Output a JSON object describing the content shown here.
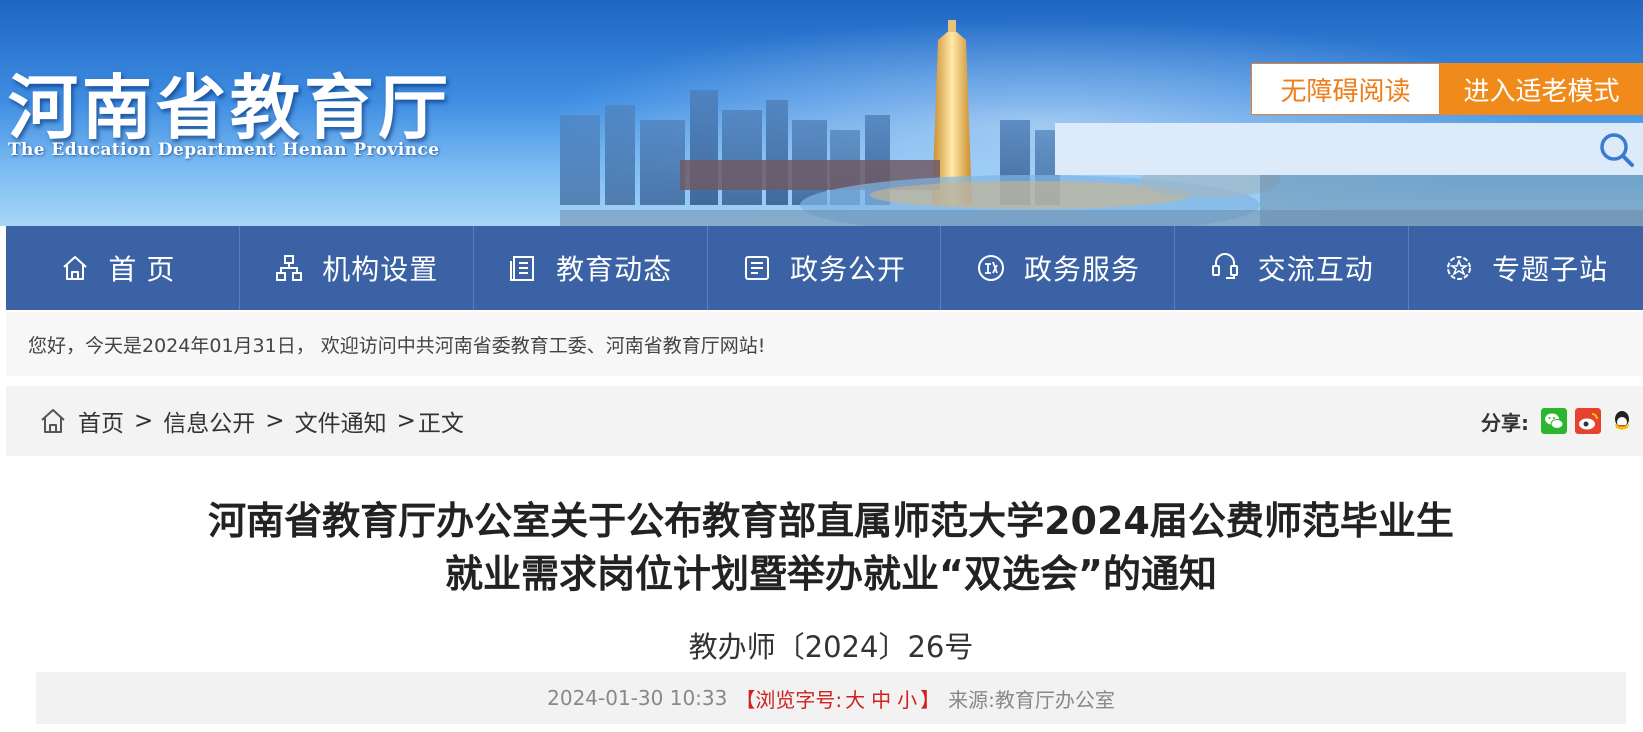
{
  "header": {
    "logo_cn": "河南省教育厅",
    "logo_en": "The Education Department Henan Province",
    "accessible_label": "无障碍阅读",
    "elder_mode_label": "进入适老模式",
    "search_placeholder": ""
  },
  "nav": {
    "items": [
      {
        "label": "首页",
        "icon": "home-icon"
      },
      {
        "label": "机构设置",
        "icon": "org-chart-icon"
      },
      {
        "label": "教育动态",
        "icon": "news-icon"
      },
      {
        "label": "政务公开",
        "icon": "open-gov-icon"
      },
      {
        "label": "政务服务",
        "icon": "gov-service-icon"
      },
      {
        "label": "交流互动",
        "icon": "interaction-icon"
      },
      {
        "label": "专题子站",
        "icon": "topic-site-icon"
      }
    ]
  },
  "welcome": {
    "text": "您好，今天是2024年01月31日， 欢迎访问中共河南省委教育工委、河南省教育厅网站!"
  },
  "breadcrumb": {
    "items": [
      "首页",
      "信息公开",
      "文件通知"
    ],
    "current": "正文",
    "separator": ">"
  },
  "share": {
    "label": "分享:",
    "icons": [
      "wechat-icon",
      "weibo-icon",
      "qq-icon"
    ]
  },
  "article": {
    "title_line1": "河南省教育厅办公室关于公布教育部直属师范大学2024届公费师范毕业生",
    "title_line2": "就业需求岗位计划暨举办就业“双选会”的通知",
    "doc_number": "教办师〔2024〕26号",
    "date": "2024-01-30 10:33",
    "font_size_open": "【浏览字号:",
    "font_large": "大",
    "font_medium": "中",
    "font_small": "小",
    "font_size_close": "】",
    "source_label": "来源:",
    "source": "教育厅办公室"
  },
  "colors": {
    "nav_bg": "#3b62a5",
    "accent_orange": "#f08a1b",
    "font_size_red": "#d11f1f"
  }
}
